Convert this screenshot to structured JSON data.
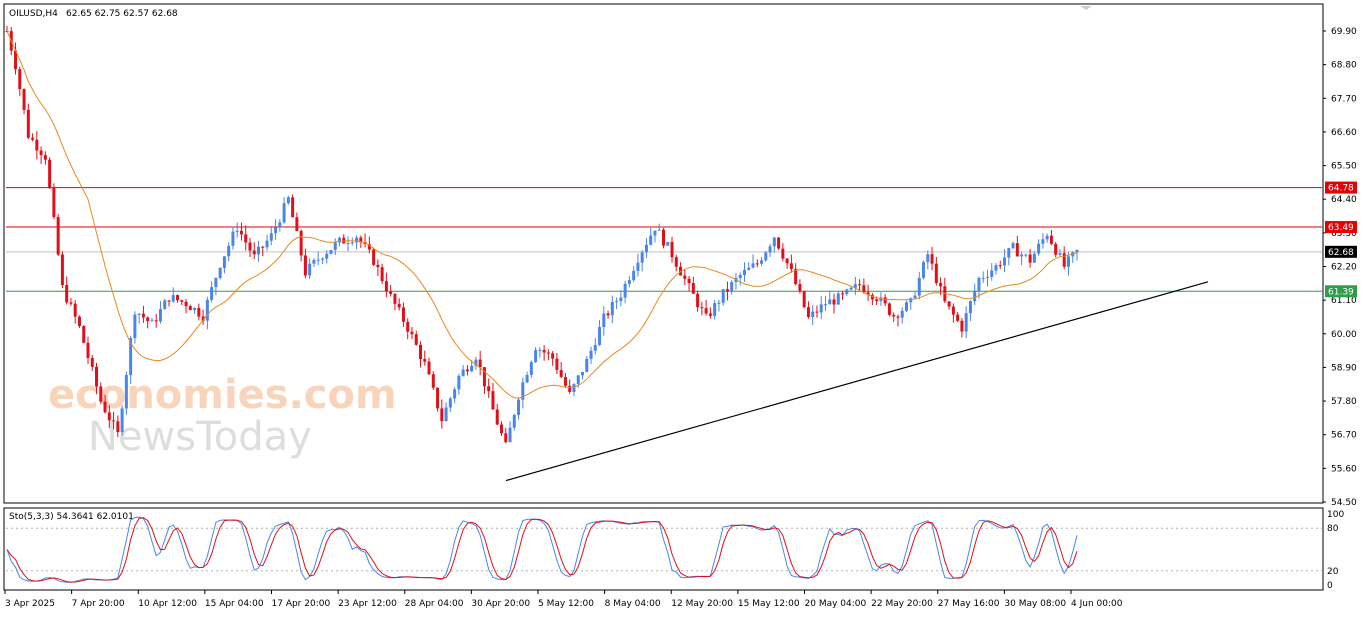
{
  "header": {
    "symbol": "OILUSD,H4",
    "ohlc": "62.65 62.75 62.57 62.68"
  },
  "watermark": {
    "line1": "economies.com",
    "line2": "NewsToday"
  },
  "price_axis": {
    "labels": [
      "69.90",
      "68.80",
      "67.70",
      "66.60",
      "65.50",
      "64.40",
      "63.30",
      "62.20",
      "61.10",
      "60.00",
      "58.90",
      "57.80",
      "56.70",
      "55.60",
      "54.50"
    ],
    "min": 54.5,
    "max": 69.9
  },
  "time_axis": {
    "labels": [
      "3 Apr 2025",
      "7 Apr 20:00",
      "10 Apr 12:00",
      "15 Apr 04:00",
      "17 Apr 20:00",
      "23 Apr 12:00",
      "28 Apr 04:00",
      "30 Apr 20:00",
      "5 May 12:00",
      "8 May 04:00",
      "12 May 20:00",
      "15 May 12:00",
      "20 May 04:00",
      "22 May 20:00",
      "27 May 16:00",
      "30 May 08:00",
      "4 Jun 00:00"
    ]
  },
  "levels": [
    {
      "value": 64.78,
      "label": "64.78",
      "color": "#e60000"
    },
    {
      "value": 63.49,
      "label": "63.49",
      "color": "#e60000"
    },
    {
      "value": 62.68,
      "label": "62.68",
      "color": "#000000"
    },
    {
      "value": 61.39,
      "label": "61.39",
      "color": "#2e9e48"
    }
  ],
  "colors": {
    "bull": "#4a86e8",
    "bear": "#e0101a",
    "ma": "#e8891e",
    "stoch_main": "#4a86e8",
    "stoch_signal": "#e0101a"
  },
  "stochastic": {
    "label": "Sto(5,3,3) 54.3641 62.0101",
    "levels": [
      "100",
      "80",
      "20",
      "0"
    ]
  },
  "chart_data": {
    "type": "candlestick",
    "title": "OILUSD,H4",
    "ylim": [
      54.5,
      69.9
    ],
    "horizontal_lines": [
      64.78,
      63.49,
      62.68,
      61.39
    ],
    "trendline": {
      "from": [
        "1 May",
        55.2
      ],
      "to": [
        "6 Jun",
        61.7
      ]
    },
    "price_path": [
      [
        0,
        69.9
      ],
      [
        2,
        68.8
      ],
      [
        5,
        66.5
      ],
      [
        9,
        65.8
      ],
      [
        13,
        61.5
      ],
      [
        17,
        60.2
      ],
      [
        22,
        57.8
      ],
      [
        26,
        56.7
      ],
      [
        30,
        60.8
      ],
      [
        34,
        60.3
      ],
      [
        38,
        61.2
      ],
      [
        42,
        61.0
      ],
      [
        46,
        60.6
      ],
      [
        50,
        62.3
      ],
      [
        54,
        63.5
      ],
      [
        58,
        62.5
      ],
      [
        62,
        63.2
      ],
      [
        66,
        64.4
      ],
      [
        70,
        62.0
      ],
      [
        74,
        62.6
      ],
      [
        78,
        63.0
      ],
      [
        82,
        63.2
      ],
      [
        86,
        62.4
      ],
      [
        90,
        61.2
      ],
      [
        94,
        60.2
      ],
      [
        98,
        59.0
      ],
      [
        102,
        57.2
      ],
      [
        106,
        58.6
      ],
      [
        110,
        59.3
      ],
      [
        114,
        57.5
      ],
      [
        117,
        56.3
      ],
      [
        120,
        58.0
      ],
      [
        124,
        59.6
      ],
      [
        128,
        59.2
      ],
      [
        132,
        58.0
      ],
      [
        136,
        59.1
      ],
      [
        140,
        60.5
      ],
      [
        144,
        61.3
      ],
      [
        148,
        62.5
      ],
      [
        152,
        63.5
      ],
      [
        156,
        62.6
      ],
      [
        160,
        61.5
      ],
      [
        164,
        60.5
      ],
      [
        168,
        61.3
      ],
      [
        172,
        61.9
      ],
      [
        176,
        62.3
      ],
      [
        180,
        63.2
      ],
      [
        184,
        62.0
      ],
      [
        188,
        60.5
      ],
      [
        192,
        61.0
      ],
      [
        196,
        61.2
      ],
      [
        200,
        61.6
      ],
      [
        204,
        61.2
      ],
      [
        208,
        60.6
      ],
      [
        212,
        61.0
      ],
      [
        216,
        62.6
      ],
      [
        220,
        61.0
      ],
      [
        224,
        60.2
      ],
      [
        228,
        61.8
      ],
      [
        232,
        62.2
      ],
      [
        236,
        62.8
      ],
      [
        240,
        62.4
      ],
      [
        244,
        63.3
      ],
      [
        248,
        62.2
      ],
      [
        251,
        62.68
      ]
    ]
  }
}
